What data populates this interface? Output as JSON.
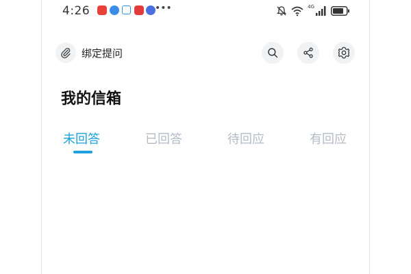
{
  "status_bar": {
    "time": "4:26",
    "network_type": "4G"
  },
  "toolbar": {
    "bind_label": "绑定提问"
  },
  "page": {
    "title": "我的信箱"
  },
  "tabs": [
    {
      "label": "未回答",
      "active": true
    },
    {
      "label": "已回答",
      "active": false
    },
    {
      "label": "待回应",
      "active": false
    },
    {
      "label": "有回应",
      "active": false
    }
  ],
  "colors": {
    "accent": "#1ea1db",
    "inactive_tab": "#b3bbc7",
    "icon_bg": "#f1f2f4"
  }
}
